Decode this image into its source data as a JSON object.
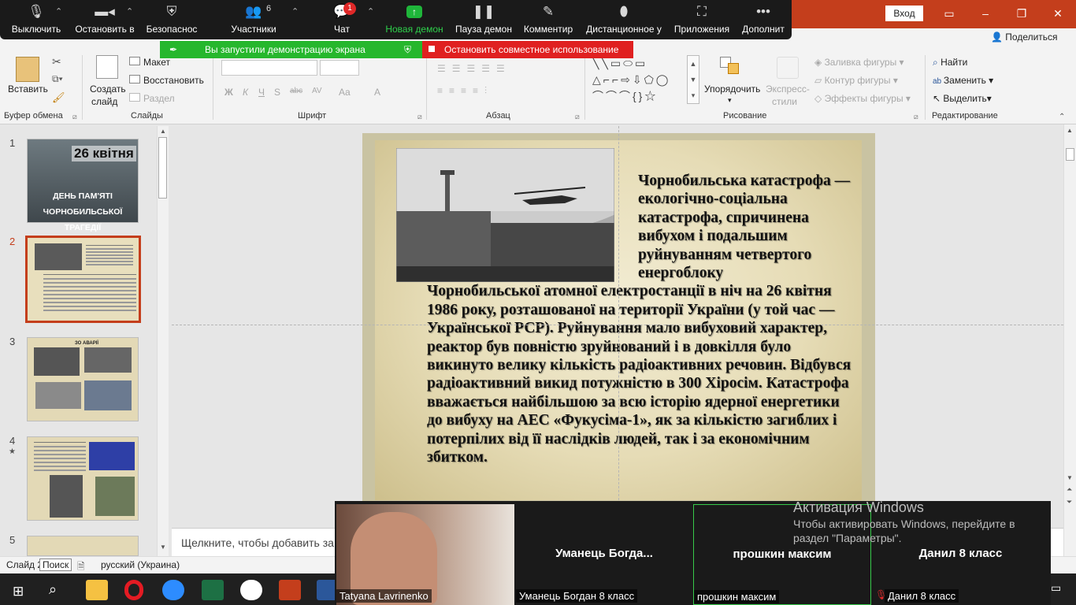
{
  "window": {
    "signin_label": "Вход",
    "share_label": "Поделиться"
  },
  "zoom_toolbar": {
    "mute": "Выключить",
    "video": "Остановить в",
    "security": "Безопаснос",
    "participants": "Участники",
    "participants_count": "6",
    "chat": "Чат",
    "chat_badge": "1",
    "new_share": "Новая демон",
    "pause_share": "Пауза демон",
    "annotate": "Комментир",
    "remote": "Дистанционное у",
    "apps": "Приложения",
    "more": "Дополнит"
  },
  "share_banner": {
    "sharing_text": "Вы запустили демонстрацию экрана",
    "stop_text": "Остановить совместное использование"
  },
  "ribbon": {
    "clipboard": {
      "paste": "Вставить",
      "group": "Буфер обмена"
    },
    "slides": {
      "new_slide_line1": "Создать",
      "new_slide_line2": "слайд",
      "layout": "Макет",
      "reset": "Восстановить",
      "section": "Раздел",
      "group": "Слайды"
    },
    "font": {
      "group": "Шрифт",
      "bold": "Ж",
      "italic": "К",
      "underline": "Ч",
      "strike": "S",
      "shadow": "abc",
      "spacing": "AV",
      "case": "Aa",
      "color": "A"
    },
    "paragraph": {
      "group": "Абзац"
    },
    "drawing": {
      "arrange": "Упорядочить",
      "quick_styles_line1": "Экспресс-",
      "quick_styles_line2": "стили",
      "fill": "Заливка фигуры",
      "outline": "Контур фигуры",
      "effects": "Эффекты фигуры",
      "group": "Рисование"
    },
    "editing": {
      "find": "Найти",
      "replace": "Заменить",
      "select": "Выделить",
      "group": "Редактирование"
    }
  },
  "thumbnails": [
    {
      "num": "1",
      "title": "26 квітня",
      "subtitle": "ДЕНЬ ПАМ'ЯТІ ЧОРНОБИЛЬСЬКОЇ ТРАГЕДІЇ"
    },
    {
      "num": "2"
    },
    {
      "num": "3",
      "title": "ЗО АВАРІЇ"
    },
    {
      "num": "4",
      "star": "★"
    },
    {
      "num": "5"
    }
  ],
  "slide": {
    "text_lead": "Чорнобильська катастрофа — екологічно-соціальна катастрофа, спричинена вибухом і подальшим руйнуванням четвертого енергоблоку",
    "text_body": "Чорнобильської атомної електростанції в ніч на 26 квітня 1986 року, розташованої на території України (у той час — Української РСР). Руйнування мало вибуховий характер, реактор був повністю зруйнований і в довкілля було викинуто велику кількість радіоактивних речовин. Відбувся радіоактивний викид потужністю в 300 Хіросім. Катастрофа вважається найбільшою за всю історію ядерної енергетики до вибуху на АЕС «Фукусіма-1», як за кількістю загиблих і потерпілих від її наслідків людей, так і за економічним збитком."
  },
  "notes_placeholder": "Щелкните, чтобы добавить за",
  "status": {
    "slide": "Слайд 2",
    "search_tooltip": "Поиск",
    "language": "русский (Украина)"
  },
  "video": {
    "tiles": [
      {
        "label": "Tatyana Lavrinenko"
      },
      {
        "name": "Уманець Богда...",
        "label": "Уманець Богдан 8 класс"
      },
      {
        "name": "прошкин максим",
        "label": "прошкин максим"
      },
      {
        "name": "Данил 8 класс",
        "label": "Данил 8 класс"
      }
    ]
  },
  "watermark": {
    "title": "Активация Windows",
    "line1": "Чтобы активировать Windows, перейдите в",
    "line2": "раздел \"Параметры\"."
  }
}
